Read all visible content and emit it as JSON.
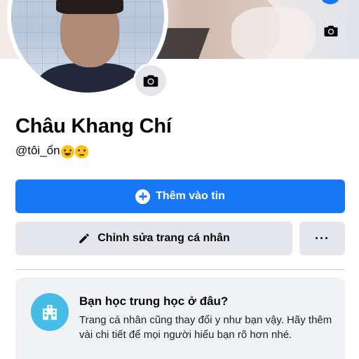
{
  "profile": {
    "name": "Châu Khang Chí",
    "handle": "@tôi_ổn",
    "handle_emojis": [
      "grinning-sweat-emoji",
      "eye-roll-emoji"
    ]
  },
  "actions": {
    "add_story_label": "Thêm vào tin",
    "edit_profile_label": "Chỉnh sửa trang cá nhân",
    "more_label": "···"
  },
  "prompt_card": {
    "title": "Bạn học trung học ở đâu?",
    "body": "Trang cá nhân cũng thay đổi y như bạn vậy. Hãy thêm vài chi tiết để mọi người hiểu bạn rõ hơn nhé."
  },
  "icons": {
    "cover_camera": "camera-icon",
    "avatar_camera": "camera-icon",
    "add_story": "plus-circle-icon",
    "edit": "pencil-icon",
    "school": "school-building-icon"
  },
  "colors": {
    "primary": "#1877f2",
    "secondary_bg": "#e4e6eb",
    "card_bg": "#f0f2f5",
    "school_icon_bg": "#45bde6"
  }
}
